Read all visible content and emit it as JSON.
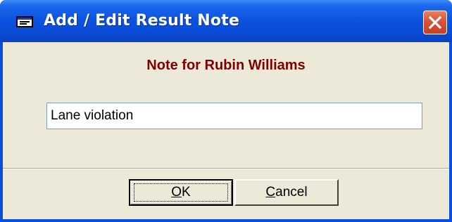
{
  "window": {
    "title": "Add / Edit Result Note",
    "close_icon": "close-x-icon",
    "app_icon": "app-window-icon"
  },
  "dialog": {
    "heading": "Note for Rubin Williams",
    "heading_color": "#800000",
    "note_value": "Lane violation"
  },
  "buttons": {
    "ok": {
      "mnemonic": "O",
      "rest": "K"
    },
    "cancel": {
      "mnemonic": "C",
      "rest": "ancel"
    }
  },
  "colors": {
    "titlebar": "#0a4ad4",
    "client": "#ece9d8",
    "close_button": "#d9533a"
  }
}
